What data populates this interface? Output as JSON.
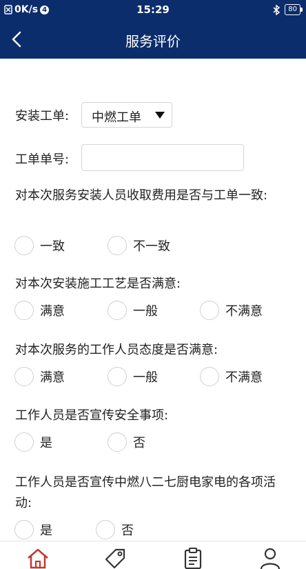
{
  "status_bar": {
    "speed": "0K/s",
    "notification_count": "4",
    "time": "15:29",
    "battery": "80"
  },
  "header": {
    "title": "服务评价"
  },
  "form": {
    "install_order_label": "安装工单:",
    "install_order_value": "中燃工单",
    "order_number_label": "工单单号:",
    "order_number_value": "",
    "questions": [
      {
        "text": "对本次服务安装人员收取费用是否与工单一致:",
        "options": [
          "一致",
          "不一致"
        ]
      },
      {
        "text": "对本次安装施工工艺是否满意:",
        "options": [
          "满意",
          "一般",
          "不满意"
        ]
      },
      {
        "text": "对本次服务的工作人员态度是否满意:",
        "options": [
          "满意",
          "一般",
          "不满意"
        ]
      },
      {
        "text": "工作人员是否宣传安全事项:",
        "options": [
          "是",
          "否"
        ]
      },
      {
        "text": "工作人员是否宣传中燃八二七厨电家电的各项活动:",
        "options": [
          "是",
          "否"
        ]
      }
    ]
  },
  "tab_bar": {
    "icons": [
      "home-icon",
      "tag-icon",
      "clipboard-icon",
      "user-icon"
    ],
    "active_color": "#c0392b"
  }
}
